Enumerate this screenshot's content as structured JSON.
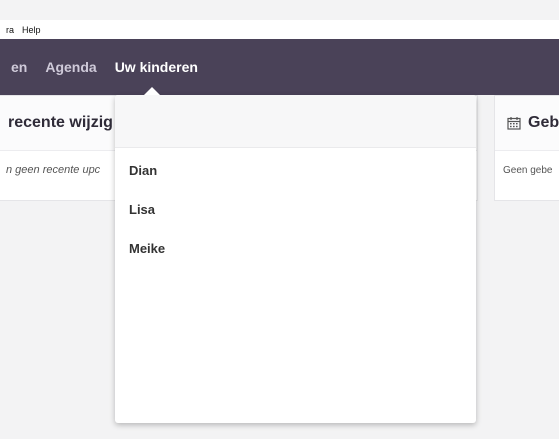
{
  "menubar": {
    "items": [
      "ra",
      "Help"
    ]
  },
  "navbar": {
    "items": [
      "en",
      "Agenda",
      "Uw kinderen"
    ],
    "active_index": 2
  },
  "recent": {
    "title": "recente wijzig",
    "empty": "n geen recente upc"
  },
  "events": {
    "title": "Geb",
    "empty": "Geen gebe",
    "icon": "calendar-icon"
  },
  "dropdown": {
    "children": [
      "Dian",
      "Lisa",
      "Meike"
    ]
  },
  "colors": {
    "navbar": "#4a4258",
    "background": "#f3f3f4"
  }
}
